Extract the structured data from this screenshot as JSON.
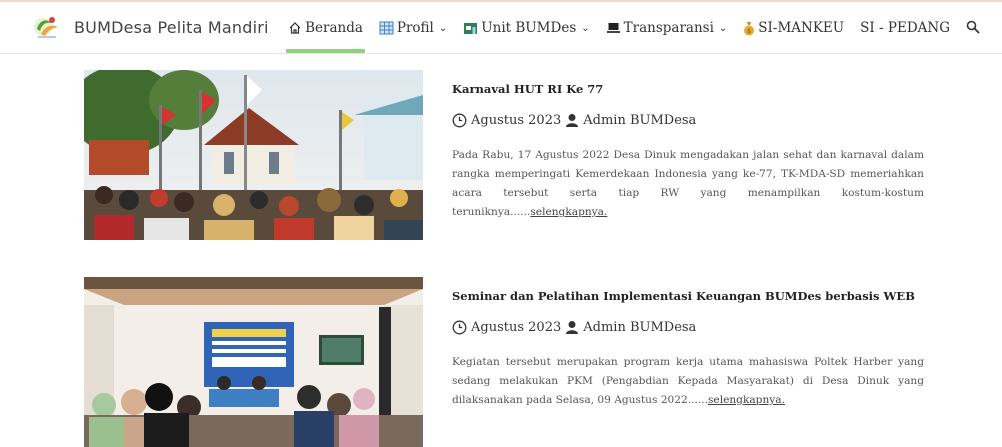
{
  "site": {
    "name": "BUMDesa Pelita Mandiri"
  },
  "nav": {
    "items": [
      {
        "label": "Beranda",
        "icon": "home-icon"
      },
      {
        "label": "Profil",
        "icon": "table-icon"
      },
      {
        "label": "Unit BUMDes",
        "icon": "store-icon"
      },
      {
        "label": "Transparansi",
        "icon": "laptop-icon"
      },
      {
        "label": "SI-MANKEU",
        "icon": "moneybag-icon"
      },
      {
        "label": "SI - PEDANG"
      }
    ],
    "search_icon": "search-icon",
    "accent": "#8bd37c"
  },
  "posts": [
    {
      "title": "Karnaval HUT RI Ke 77",
      "date": "Agustus 2023",
      "author": "Admin BUMDesa",
      "excerpt": "Pada Rabu, 17 Agustus 2022 Desa Dinuk mengadakan jalan sehat dan karnaval dalam rangka memperingati Kemerdekaan Indonesia yang ke-77, TK-MDA-SD memeriahkan acara tersebut serta tiap RW yang menampilkan kostum-kostum teruniknya......",
      "more": "selengkapnya."
    },
    {
      "title": "Seminar dan Pelatihan Implementasi Keuangan BUMDes berbasis WEB",
      "date": "Agustus 2023",
      "author": "Admin BUMDesa",
      "excerpt": "Kegiatan tersebut merupakan program kerja utama mahasiswa Poltek Harber yang sedang melakukan PKM (Pengabdian Kepada Masyarakat) di Desa Dinuk yang dilaksanakan pada Selasa, 09 Agustus 2022......",
      "more": "selengkapnya."
    }
  ]
}
